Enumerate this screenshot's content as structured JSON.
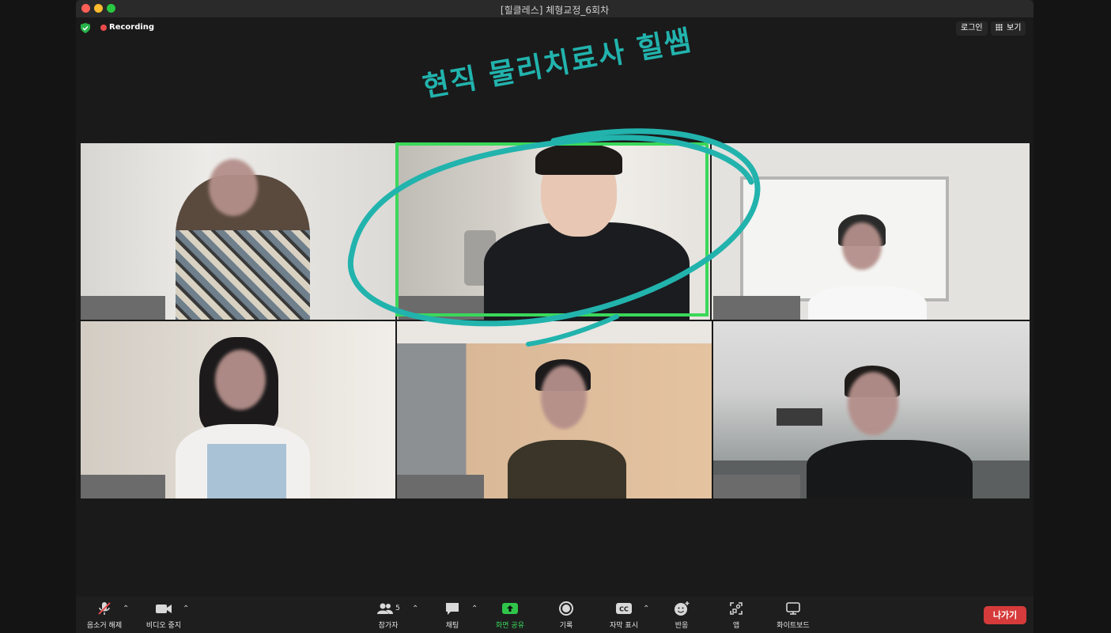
{
  "window": {
    "title": "[힐클레스] 체형교정_6회차"
  },
  "topbar": {
    "recording": "Recording",
    "login": "로그인",
    "view": "보기"
  },
  "annotation": {
    "text": "현직 물리치료사 힐쌤"
  },
  "toolbar": {
    "unmute": "음소거 해제",
    "video_stop": "비디오 중지",
    "participants": "참가자",
    "participant_count": "5",
    "chat": "채팅",
    "share_screen": "화면 공유",
    "record": "기록",
    "captions": "자막 표시",
    "reactions": "반응",
    "apps": "앱",
    "whiteboard": "화이트보드",
    "leave": "나가기"
  },
  "colors": {
    "accent_green": "#3ad85a",
    "annotation": "#22b3ad",
    "leave_red": "#d63b3b"
  }
}
